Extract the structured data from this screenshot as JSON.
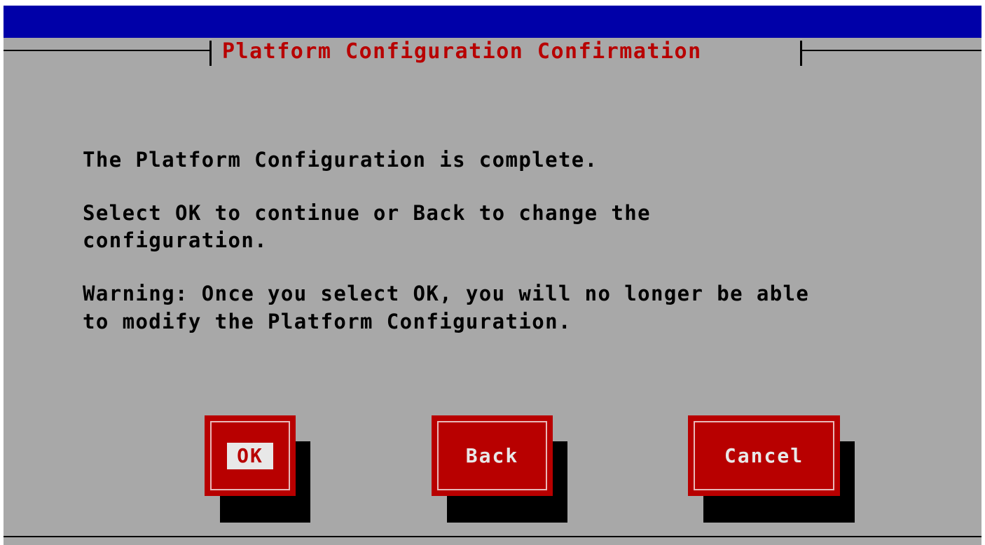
{
  "dialog": {
    "title": "Platform Configuration Confirmation",
    "message_line1": "The Platform Configuration is complete.",
    "message_line2": "Select OK to continue or Back to change the",
    "message_line3": "configuration.",
    "message_line4": "Warning: Once you select OK, you will no longer be able",
    "message_line5": "to modify the Platform Configuration."
  },
  "buttons": {
    "ok_label": "OK",
    "back_label": "Back",
    "cancel_label": "Cancel",
    "focused": "OK"
  },
  "colors": {
    "background": "#a8a8a8",
    "top_bar": "#0000a8",
    "accent_red": "#b80000",
    "text": "#000000"
  }
}
